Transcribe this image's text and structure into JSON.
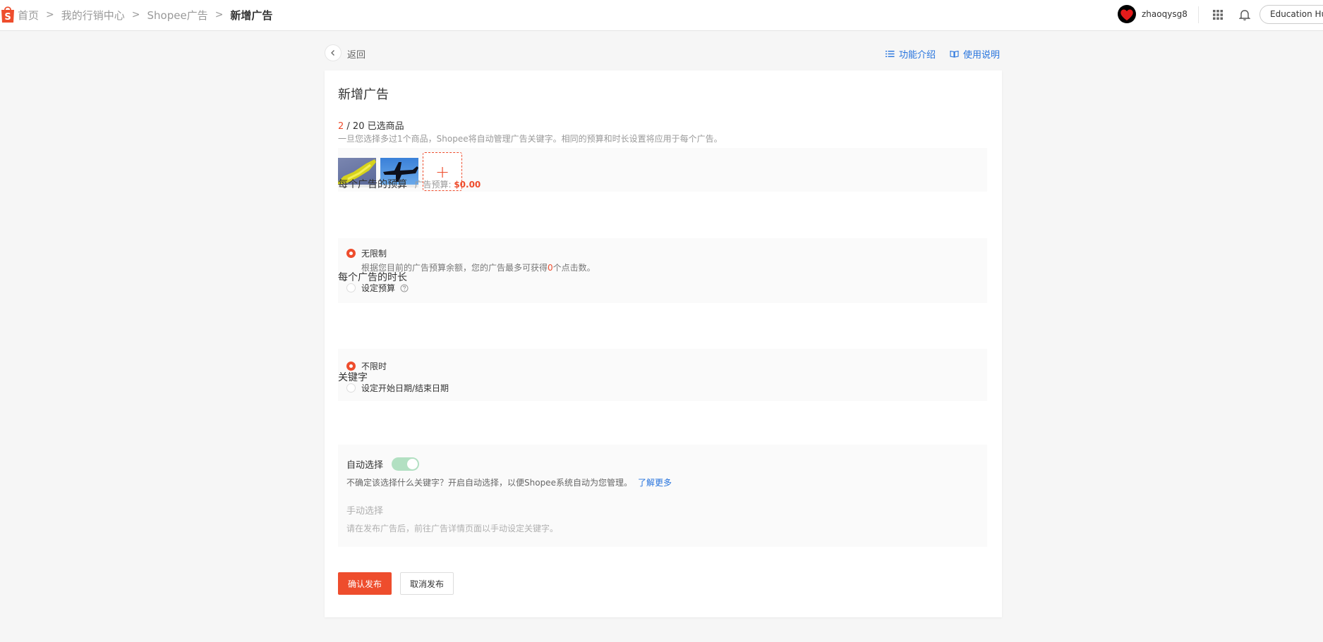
{
  "nav": {
    "breadcrumbs": [
      "首页",
      "我的行销中心",
      "Shopee广告",
      "新增广告"
    ],
    "username": "zhaoqysg8",
    "edu_hub": "Education Hub",
    "logo_letter": "S"
  },
  "subheader": {
    "back_label": "返回",
    "feature_intro": "功能介绍",
    "usage_guide": "使用说明"
  },
  "page": {
    "title": "新增广告",
    "selected_count": "2",
    "selected_total": " / 20 已选商品",
    "selected_desc": "一旦您选择多过1个商品，Shopee将自动管理广告关键字。相同的预算和时长设置将应用于每个广告。",
    "add_symbol": "+"
  },
  "budget": {
    "title": "每个广告的预算",
    "hint_label": "广告预算:",
    "hint_amount": "$0.00",
    "unlimited_label": "无限制",
    "unlimited_desc_pre": "根据您目前的广告预算余额，您的广告最多可获得",
    "unlimited_desc_num": "0",
    "unlimited_desc_post": "个点击数。",
    "set_budget_label": "设定预算"
  },
  "duration": {
    "title": "每个广告的时长",
    "unlimited_label": "不限时",
    "set_dates_label": "设定开始日期/结束日期"
  },
  "keywords": {
    "title": "关键字",
    "auto_label": "自动选择",
    "auto_enabled": true,
    "auto_desc": "不确定该选择什么关键字？开启自动选择，以便Shopee系统自动为您管理。",
    "learn_more": "了解更多",
    "manual_label": "手动选择",
    "manual_desc": "请在发布广告后，前往广告详情页面以手动设定关键字。"
  },
  "actions": {
    "confirm": "确认发布",
    "cancel": "取消发布"
  },
  "colors": {
    "brand": "#ee4d2d",
    "link": "#2673dd",
    "toggle_on": "#b2e0c2"
  }
}
